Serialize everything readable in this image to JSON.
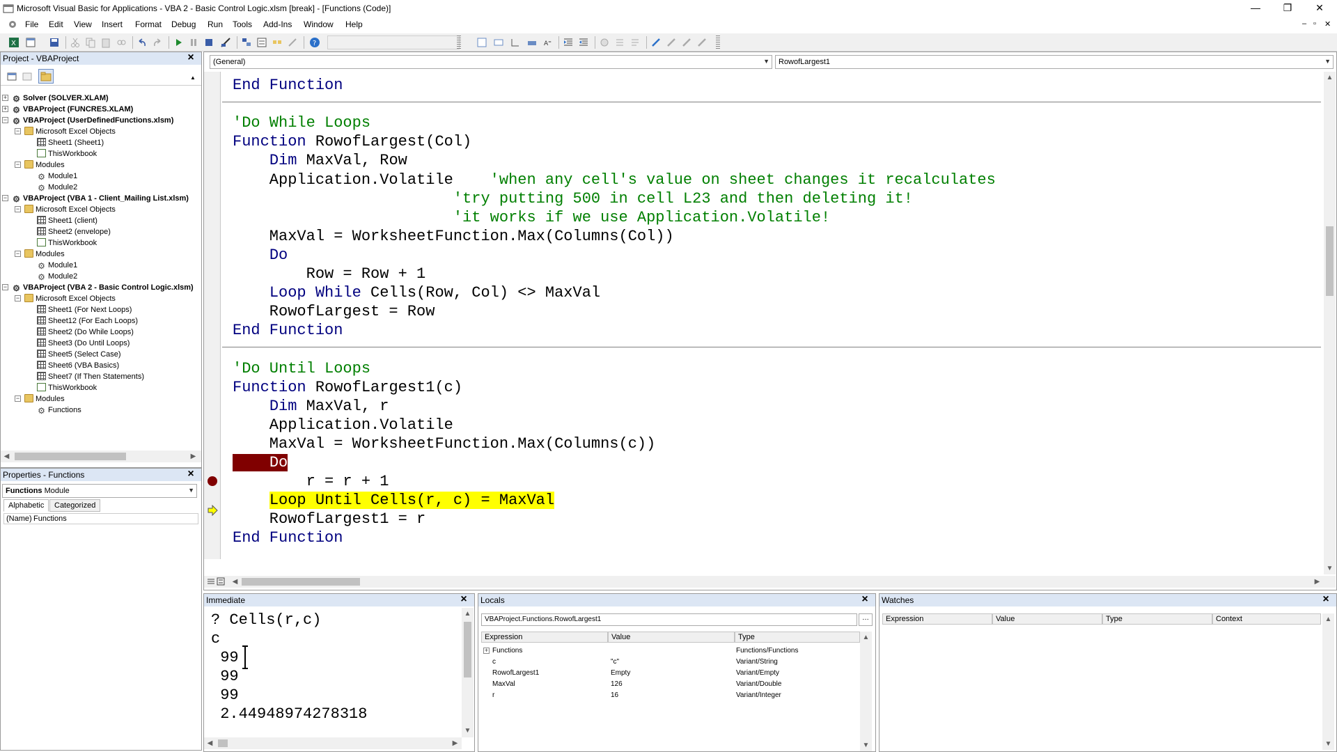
{
  "window": {
    "title": "Microsoft Visual Basic for Applications - VBA 2 - Basic Control Logic.xlsm [break] - [Functions (Code)]",
    "controls": [
      "—",
      "❐",
      "✕"
    ]
  },
  "menu": [
    "File",
    "Edit",
    "View",
    "Insert",
    "Format",
    "Debug",
    "Run",
    "Tools",
    "Add-Ins",
    "Window",
    "Help"
  ],
  "mdi_controls": [
    "–",
    "▫",
    "✕"
  ],
  "project": {
    "title": "Project - VBAProject",
    "tree": [
      {
        "label": "Solver (SOLVER.XLAM)",
        "bold": true,
        "level": 0,
        "icon": "proj",
        "exp": "+"
      },
      {
        "label": "VBAProject (FUNCRES.XLAM)",
        "bold": true,
        "level": 0,
        "icon": "proj",
        "exp": "+"
      },
      {
        "label": "VBAProject (UserDefinedFunctions.xlsm)",
        "bold": true,
        "level": 0,
        "icon": "proj",
        "exp": "−"
      },
      {
        "label": "Microsoft Excel Objects",
        "bold": false,
        "level": 1,
        "icon": "folder",
        "exp": "−"
      },
      {
        "label": "Sheet1 (Sheet1)",
        "bold": false,
        "level": 2,
        "icon": "sheet",
        "exp": ""
      },
      {
        "label": "ThisWorkbook",
        "bold": false,
        "level": 2,
        "icon": "wb",
        "exp": ""
      },
      {
        "label": "Modules",
        "bold": false,
        "level": 1,
        "icon": "folder",
        "exp": "−"
      },
      {
        "label": "Module1",
        "bold": false,
        "level": 2,
        "icon": "mod",
        "exp": ""
      },
      {
        "label": "Module2",
        "bold": false,
        "level": 2,
        "icon": "mod",
        "exp": ""
      },
      {
        "label": "VBAProject (VBA 1 - Client_Mailing List.xlsm)",
        "bold": true,
        "level": 0,
        "icon": "proj",
        "exp": "−"
      },
      {
        "label": "Microsoft Excel Objects",
        "bold": false,
        "level": 1,
        "icon": "folder",
        "exp": "−"
      },
      {
        "label": "Sheet1 (client)",
        "bold": false,
        "level": 2,
        "icon": "sheet",
        "exp": ""
      },
      {
        "label": "Sheet2 (envelope)",
        "bold": false,
        "level": 2,
        "icon": "sheet",
        "exp": ""
      },
      {
        "label": "ThisWorkbook",
        "bold": false,
        "level": 2,
        "icon": "wb",
        "exp": ""
      },
      {
        "label": "Modules",
        "bold": false,
        "level": 1,
        "icon": "folder",
        "exp": "−"
      },
      {
        "label": "Module1",
        "bold": false,
        "level": 2,
        "icon": "mod",
        "exp": ""
      },
      {
        "label": "Module2",
        "bold": false,
        "level": 2,
        "icon": "mod",
        "exp": ""
      },
      {
        "label": "VBAProject (VBA 2 - Basic Control Logic.xlsm)",
        "bold": true,
        "level": 0,
        "icon": "proj",
        "exp": "−"
      },
      {
        "label": "Microsoft Excel Objects",
        "bold": false,
        "level": 1,
        "icon": "folder",
        "exp": "−"
      },
      {
        "label": "Sheet1 (For Next Loops)",
        "bold": false,
        "level": 2,
        "icon": "sheet",
        "exp": ""
      },
      {
        "label": "Sheet12 (For Each Loops)",
        "bold": false,
        "level": 2,
        "icon": "sheet",
        "exp": ""
      },
      {
        "label": "Sheet2 (Do While Loops)",
        "bold": false,
        "level": 2,
        "icon": "sheet",
        "exp": ""
      },
      {
        "label": "Sheet3 (Do Until Loops)",
        "bold": false,
        "level": 2,
        "icon": "sheet",
        "exp": ""
      },
      {
        "label": "Sheet5 (Select Case)",
        "bold": false,
        "level": 2,
        "icon": "sheet",
        "exp": ""
      },
      {
        "label": "Sheet6 (VBA Basics)",
        "bold": false,
        "level": 2,
        "icon": "sheet",
        "exp": ""
      },
      {
        "label": "Sheet7 (If Then Statements)",
        "bold": false,
        "level": 2,
        "icon": "sheet",
        "exp": ""
      },
      {
        "label": "ThisWorkbook",
        "bold": false,
        "level": 2,
        "icon": "wb",
        "exp": ""
      },
      {
        "label": "Modules",
        "bold": false,
        "level": 1,
        "icon": "folder",
        "exp": "−"
      },
      {
        "label": "Functions",
        "bold": false,
        "level": 2,
        "icon": "mod",
        "exp": ""
      }
    ]
  },
  "properties": {
    "title": "Properties - Functions",
    "object_name": "Functions",
    "object_type": "Module",
    "tabs": [
      "Alphabetic",
      "Categorized"
    ],
    "rows": [
      {
        "name": "(Name)",
        "value": "Functions"
      }
    ]
  },
  "code": {
    "object_combo": "(General)",
    "proc_combo": "RowofLargest1",
    "lines": [
      [
        {
          "t": "End Function",
          "c": "kw"
        }
      ],
      [],
      [
        {
          "t": "'Do While Loops",
          "c": "cm"
        }
      ],
      [
        {
          "t": "Function",
          "c": "kw"
        },
        {
          "t": " RowofLargest(Col)",
          "c": ""
        }
      ],
      [
        {
          "t": "    ",
          "c": ""
        },
        {
          "t": "Dim",
          "c": "kw"
        },
        {
          "t": " MaxVal, Row",
          "c": ""
        }
      ],
      [
        {
          "t": "    Application.Volatile    ",
          "c": ""
        },
        {
          "t": "'when any cell's value on sheet changes it recalculates",
          "c": "cm"
        }
      ],
      [
        {
          "t": "                        ",
          "c": ""
        },
        {
          "t": "'try putting 500 in cell L23 and then deleting it!",
          "c": "cm"
        }
      ],
      [
        {
          "t": "                        ",
          "c": ""
        },
        {
          "t": "'it works if we use Application.Volatile!",
          "c": "cm"
        }
      ],
      [
        {
          "t": "    MaxVal = WorksheetFunction.Max(Columns(Col))",
          "c": ""
        }
      ],
      [
        {
          "t": "    ",
          "c": ""
        },
        {
          "t": "Do",
          "c": "kw"
        }
      ],
      [
        {
          "t": "        Row = Row + 1",
          "c": ""
        }
      ],
      [
        {
          "t": "    ",
          "c": ""
        },
        {
          "t": "Loop While",
          "c": "kw"
        },
        {
          "t": " Cells(Row, Col) <> MaxVal",
          "c": ""
        }
      ],
      [
        {
          "t": "    RowofLargest = Row",
          "c": ""
        }
      ],
      [
        {
          "t": "End Function",
          "c": "kw"
        }
      ],
      [],
      [
        {
          "t": "'Do Until Loops",
          "c": "cm"
        }
      ],
      [
        {
          "t": "Function",
          "c": "kw"
        },
        {
          "t": " RowofLargest1(c)",
          "c": ""
        }
      ],
      [
        {
          "t": "    ",
          "c": ""
        },
        {
          "t": "Dim",
          "c": "kw"
        },
        {
          "t": " MaxVal, r",
          "c": ""
        }
      ],
      [
        {
          "t": "    Application.Volatile",
          "c": ""
        }
      ],
      [
        {
          "t": "    MaxVal = WorksheetFunction.Max(Columns(c))",
          "c": ""
        }
      ],
      [
        {
          "t": "    ",
          "c": "hl-break"
        },
        {
          "t": "Do",
          "c": "hl-break"
        }
      ],
      [
        {
          "t": "        r = r + 1",
          "c": ""
        }
      ],
      [
        {
          "t": "    ",
          "c": ""
        },
        {
          "t": "Loop Until Cells(r, c) = MaxVal",
          "c": "hl-exec"
        }
      ],
      [
        {
          "t": "    RowofLargest1 = r",
          "c": ""
        }
      ],
      [
        {
          "t": "End Function",
          "c": "kw"
        }
      ]
    ]
  },
  "immediate": {
    "title": "Immediate",
    "lines": [
      "? Cells(r,c)",
      "c",
      " 99",
      " 99",
      " 99",
      " 2.44948974278318"
    ]
  },
  "locals": {
    "title": "Locals",
    "context": "VBAProject.Functions.RowofLargest1",
    "headers": [
      "Expression",
      "Value",
      "Type"
    ],
    "rows": [
      {
        "expr": "Functions",
        "value": "",
        "type": "Functions/Functions",
        "exp": "+"
      },
      {
        "expr": "c",
        "value": "\"c\"",
        "type": "Variant/String",
        "exp": ""
      },
      {
        "expr": "RowofLargest1",
        "value": "Empty",
        "type": "Variant/Empty",
        "exp": ""
      },
      {
        "expr": "MaxVal",
        "value": "126",
        "type": "Variant/Double",
        "exp": ""
      },
      {
        "expr": "r",
        "value": "16",
        "type": "Variant/Integer",
        "exp": ""
      }
    ]
  },
  "watches": {
    "title": "Watches",
    "headers": [
      "Expression",
      "Value",
      "Type",
      "Context"
    ]
  },
  "colors": {
    "keyword": "#00007f",
    "comment": "#007f00",
    "breakpoint": "#800000",
    "execution": "#ffff00",
    "pane_title": "#dce6f4"
  }
}
